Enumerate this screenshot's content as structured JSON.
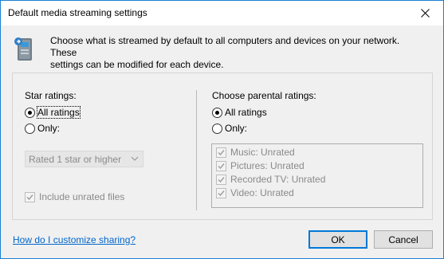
{
  "window": {
    "title": "Default media streaming settings",
    "close_icon": "close-icon"
  },
  "intro": {
    "icon": "media-device-icon",
    "line1": "Choose what is streamed by default to all computers and devices on your network.  These",
    "line2": "settings can be modified for each device."
  },
  "star_ratings": {
    "label": "Star ratings:",
    "all_label": "All ratings",
    "only_label": "Only:",
    "selected": "all",
    "dropdown_value": "Rated 1 star or higher",
    "include_unrated_label": "Include unrated files",
    "include_unrated_checked": true
  },
  "parental_ratings": {
    "label": "Choose parental ratings:",
    "all_label": "All ratings",
    "only_label": "Only:",
    "selected": "all",
    "items": [
      {
        "label": "Music: Unrated",
        "checked": true
      },
      {
        "label": "Pictures: Unrated",
        "checked": true
      },
      {
        "label": "Recorded TV: Unrated",
        "checked": true
      },
      {
        "label": "Video: Unrated",
        "checked": true
      }
    ]
  },
  "footer": {
    "help_link": "How do I customize sharing?",
    "ok_label": "OK",
    "cancel_label": "Cancel"
  },
  "colors": {
    "link": "#0066cc",
    "default_button_border": "#0078d7",
    "disabled_text": "#8a8a8a"
  }
}
